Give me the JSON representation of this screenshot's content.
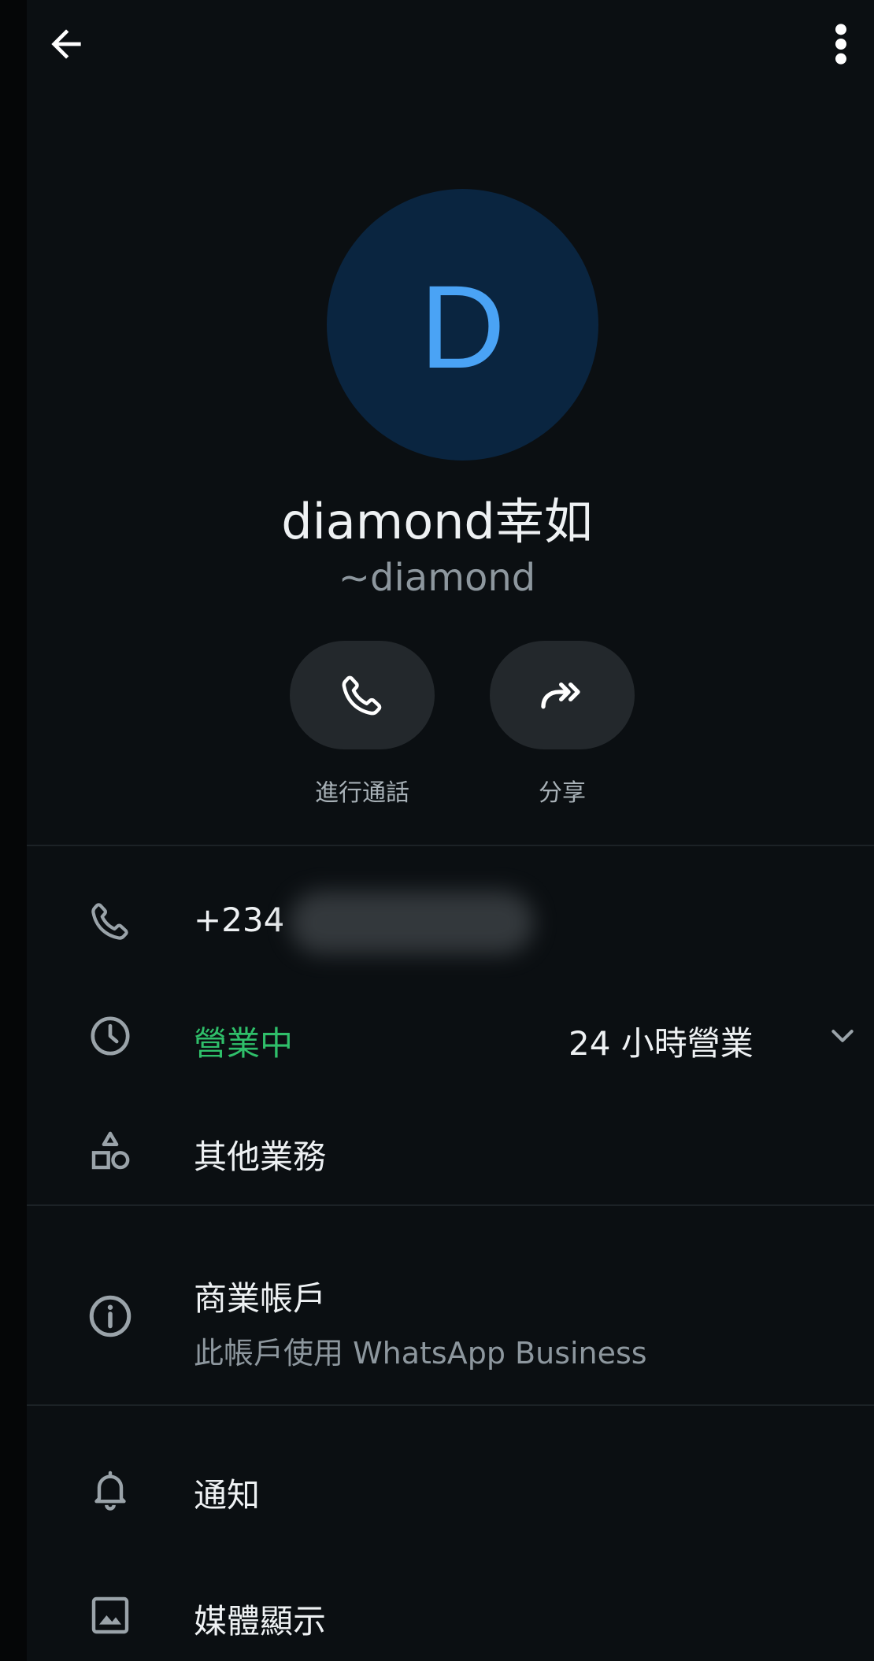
{
  "header": {
    "back_icon": "arrow-back-icon",
    "menu_icon": "more-vertical-icon"
  },
  "profile": {
    "avatar_letter": "D",
    "avatar_bg": "#0a2540",
    "avatar_fg": "#4aa3f5",
    "name": "diamond幸如",
    "push_name": "~diamond"
  },
  "actions": [
    {
      "label": "進行通話",
      "icon": "phone-icon"
    },
    {
      "label": "分享",
      "icon": "share-forward-icon"
    }
  ],
  "info": {
    "phone": "+234",
    "phone_icon": "phone-icon",
    "hours_icon": "clock-icon",
    "status": "營業中",
    "status_color": "#2fbf6a",
    "hours": "24 小時營業",
    "hours_expand_icon": "chevron-down-icon",
    "other_business_icon": "shapes-icon",
    "other_business": "其他業務"
  },
  "business": {
    "icon": "info-icon",
    "title": "商業帳戶",
    "subtitle": "此帳戶使用 WhatsApp Business"
  },
  "settings": {
    "notifications_icon": "bell-icon",
    "notifications": "通知",
    "media_icon": "image-icon",
    "media": "媒體顯示"
  }
}
